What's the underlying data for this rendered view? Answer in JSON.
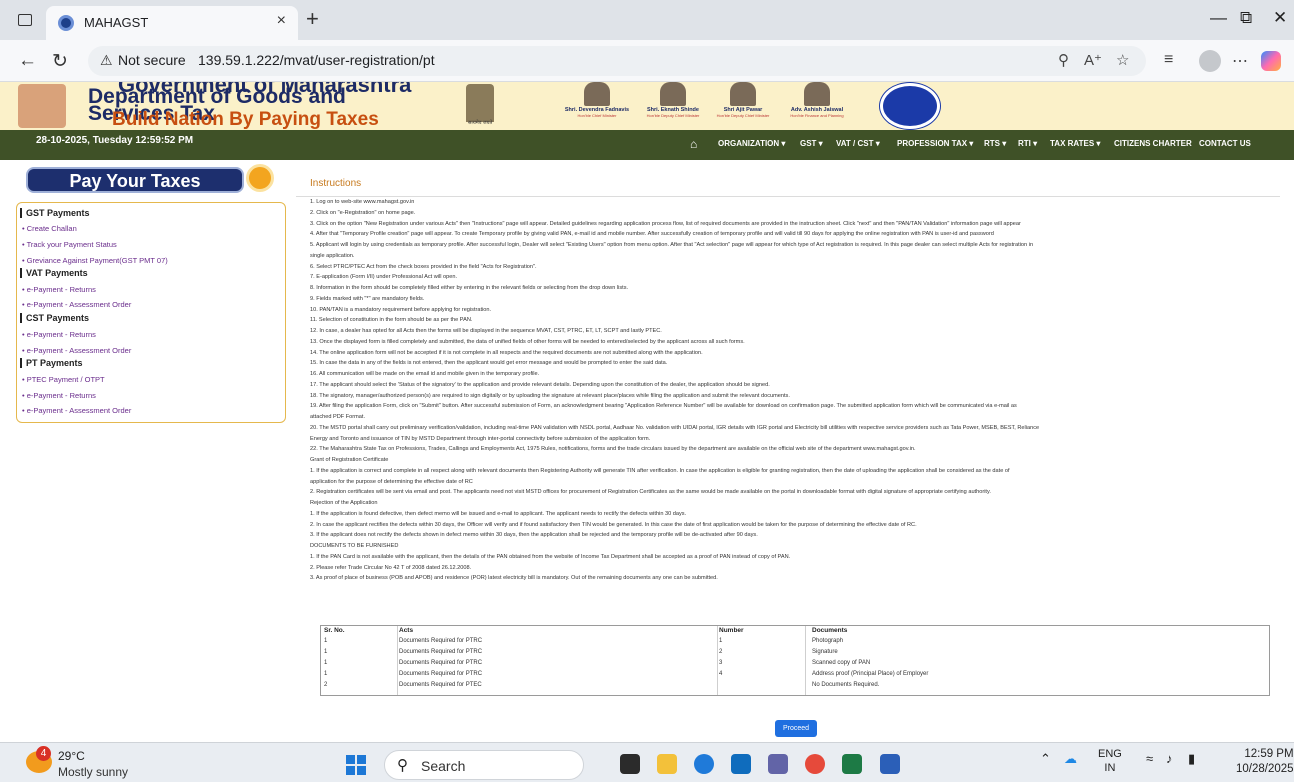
{
  "browser": {
    "tab_title": "MAHAGST",
    "tab_close": "×",
    "new_tab": "+",
    "not_secure_label": "Not secure",
    "url": "139.59.1.222/mvat/user-registration/pt"
  },
  "header": {
    "gov_line": "Government of Maharashtra",
    "dept_line1": "Department of Goods and",
    "dept_line2": "Services Tax",
    "slogan": "Build Nation By Paying Taxes",
    "emblem_caption": "सत्यमेव जयते",
    "leaders": [
      {
        "name": "Shri. Devendra Fadnavis",
        "role": "Hon'ble Chief Minister"
      },
      {
        "name": "Shri. Eknath Shinde",
        "role": "Hon'ble Deputy Chief Minister"
      },
      {
        "name": "Shri Ajit Pawar",
        "role": "Hon'ble Deputy Chief Minister"
      },
      {
        "name": "Adv. Ashish Jaiswal",
        "role": "Hon'ble Finance and Planning"
      }
    ]
  },
  "navbar": {
    "datetime": "28-10-2025, Tuesday 12:59:52 PM",
    "items": [
      "ORGANIZATION ▾",
      "GST ▾",
      "VAT / CST ▾",
      "PROFESSION TAX ▾",
      "RTS ▾",
      "RTI ▾",
      "TAX RATES ▾",
      "CITIZENS CHARTER",
      "CONTACT US"
    ]
  },
  "sidebar": {
    "banner": "Pay Your Taxes",
    "groups": [
      {
        "title": "GST Payments",
        "links": [
          "• Create Challan",
          "• Track your Payment Status",
          "• Greviance Against Payment(GST PMT 07)"
        ]
      },
      {
        "title": "VAT Payments",
        "links": [
          "• e-Payment - Returns",
          "• e-Payment - Assessment Order"
        ]
      },
      {
        "title": "CST Payments",
        "links": [
          "• e-Payment - Returns",
          "• e-Payment - Assessment Order"
        ]
      },
      {
        "title": "PT Payments",
        "links": [
          "• PTEC Payment / OTPT",
          "• e-Payment - Returns",
          "• e-Payment - Assessment Order"
        ]
      }
    ]
  },
  "instructions": {
    "title": "Instructions",
    "lines": [
      "1. Log on to web-site www.mahagst.gov.in",
      "2. Click on \"e-Registration\" on home page.",
      "3. Click on the option \"New Registration under various Acts\" then \"Instructions\" page will appear. Detailed guidelines regarding application process flow, list of required documents are provided in the instruction sheet. Click \"next\" and then \"PAN/TAN Validation\" information page will appear",
      "4. After that \"Temporary Profile creation\" page will appear. To create Temporary profile by giving valid PAN, e-mail id and mobile number. After successfully creation of temporary profile and will valid till 90 days for applying the online registration with PAN is user-id and password",
      "5. Applicant will login by using credentials as temporary profile. After successful login, Dealer will select \"Existing Users\" option from menu option. After that \"Act selection\" page will appear for which type of Act registration is required. In this page dealer can select multiple Acts for registration in",
      "single application.",
      "6. Select PTRC/PTEC Act from the check boxes provided in the field \"Acts for Registration\".",
      "7. E-application (Form I/II) under Professional Act will open.",
      "8. Information in the form should be completely filled either by entering in the relevant fields or selecting from the drop down lists.",
      "9. Fields marked with \"*\" are mandatory fields.",
      "10. PAN/TAN is a mandatory requirement before applying for registration.",
      "11. Selection of constitution in the form should be as per the PAN.",
      "12. In case, a dealer has opted for all Acts then the forms will be displayed in the sequence MVAT, CST, PTRC, ET, LT, SCPT and lastly PTEC.",
      "13. Once the displayed form is filled completely and submitted, the data of unified fields of other forms will be needed to entered/selected by the applicant across all such forms.",
      "14. The online application form will not be accepted if it is not complete in all respects and the required documents are not submitted along with the application.",
      "15. In case the data in any of the fields is not entered, then the applicant would get error message and would be prompted to enter the said data.",
      "16. All communication will be made on the email id and mobile given in the temporary profile.",
      "17. The applicant should select the 'Status of the signatory' to the application and provide relevant details. Depending upon the constitution of the dealer, the application should be signed.",
      "18. The signatory, manager/authorized person(s) are required to sign digitally or by uploading the signature at relevant place/places while filing the application and submit the relevant documents.",
      "19. After filing the application Form, click on \"Submit\" button. After successful submission of Form, an acknowledgment bearing \"Application Reference Number\" will be available for download on confirmation page. The submitted application form which will be communicated via e-mail as",
      "attached PDF Format.",
      "20. The MSTD portal shall carry out preliminary verification/validation, including real-time PAN validation with NSDL portal, Aadhaar No. validation with UIDAI portal, IGR details with IGR portal and Electricity bill utilities with respective service providers such as Tata Power, MSEB, BEST, Reliance",
      "Energy and Toronto and issuance of TIN by MSTD Department through inter-portal connectivity before submission of the application form.",
      "22. The Maharashtra State Tax on Professions, Trades, Callings and Employments Act, 1975 Rules, notifications, forms and the trade circulars issued by the department are available on the official web site of the department www.mahagst.gov.in.",
      "Grant of Registration Certificate",
      "1. If the application is correct and complete in all respect along with relevant documents then Registering Authority will generate TIN after verification. In case the application is eligible for granting registration, then the date of uploading the application shall be considered as the date of",
      "application for the purpose of determining the effective date of RC",
      "2. Registration certificates will be sent via email and post. The applicants need not visit MSTD offices for procurement of Registration Certificates as the same would be made available on the portal in downloadable format with digital signature of appropriate certifying authority.",
      "Rejection of the Application",
      "1. If the application is found defective, then defect memo will be issued and e-mail to applicant. The applicant needs to rectify the defects within 30 days.",
      "2. In case the applicant rectifies the defects within 30 days, the Officer will verify and if found satisfactory then TIN would be generated. In this case the date of first application would be taken for the purpose of determining the effective date of RC.",
      "3. If the applicant does not rectify the defects shown in defect memo within 30 days, then the application shall be rejected and the temporary profile will be de-activated after 90 days.",
      "DOCUMENTS TO BE FURNISHED",
      "1. If the PAN Card is not available with the applicant, then the details of the PAN obtained from the website of Income Tax Department shall be accepted as a proof of PAN instead of copy of PAN.",
      "2. Please refer Trade Circular No 42 T of 2008 dated 26.12.2008.",
      "3. As proof of place of business (POB and APOB) and residence (POR) latest electricity bill is mandatory. Out of the remaining documents any one can be submitted."
    ]
  },
  "documents_table": {
    "headers": [
      "Sr. No.",
      "Acts",
      "Number",
      "Documents"
    ],
    "rows": [
      [
        "1",
        "Documents Required for PTRC",
        "1",
        "Photograph"
      ],
      [
        "1",
        "Documents Required for PTRC",
        "2",
        "Signature"
      ],
      [
        "1",
        "Documents Required for PTRC",
        "3",
        "Scanned copy of PAN"
      ],
      [
        "1",
        "Documents Required for PTRC",
        "4",
        "Address proof (Principal Place) of Employer"
      ],
      [
        "2",
        "Documents Required for PTEC",
        "",
        "No Documents Required."
      ]
    ]
  },
  "proceed_label": "Proceed",
  "taskbar": {
    "weather_badge": "4",
    "temperature": "29°C",
    "weather_desc": "Mostly sunny",
    "search_label": "Search",
    "lang_line1": "ENG",
    "lang_line2": "IN",
    "time": "12:59 PM",
    "date": "10/28/2025"
  }
}
